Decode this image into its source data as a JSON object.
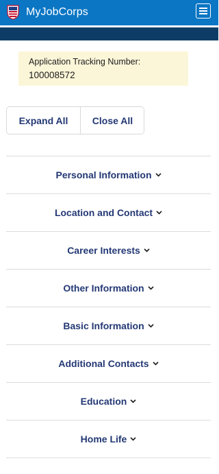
{
  "header": {
    "app_title": "MyJobCorps",
    "logo_icon": "shield-flag-logo",
    "menu_icon": "hamburger-menu-icon"
  },
  "tracking": {
    "label": "Application Tracking Number:",
    "number": "100008572"
  },
  "actions": {
    "expand_all": "Expand All",
    "close_all": "Close All"
  },
  "sections": [
    {
      "label": "Personal Information"
    },
    {
      "label": "Location and Contact"
    },
    {
      "label": "Career Interests"
    },
    {
      "label": "Other Information"
    },
    {
      "label": "Basic Information"
    },
    {
      "label": "Additional Contacts"
    },
    {
      "label": "Education"
    },
    {
      "label": "Home Life"
    }
  ],
  "colors": {
    "header_blue": "#0b76c4",
    "navy_band": "#0d3d66",
    "link_navy": "#233874",
    "tracking_bg": "#fcf6d9"
  }
}
